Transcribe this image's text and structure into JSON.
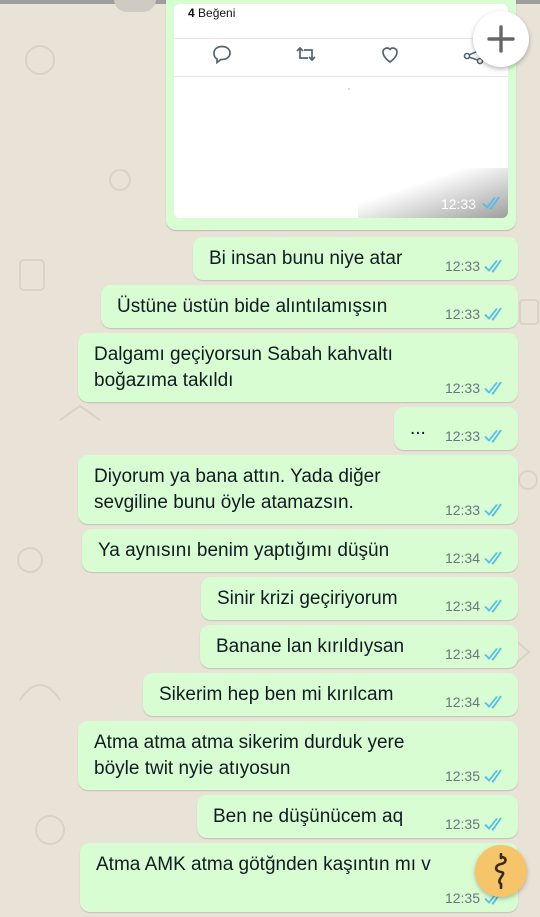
{
  "shared_post": {
    "likes_count": "4",
    "likes_label": "Beğeni",
    "time": "12:33",
    "actions": [
      "reply-icon",
      "retweet-icon",
      "like-icon",
      "share-icon"
    ]
  },
  "messages": [
    {
      "text": "Bi insan bunu niye atar",
      "time": "12:33"
    },
    {
      "text": "Üstüne üstün bide alıntılamışsın",
      "time": "12:33"
    },
    {
      "text": "Dalgamı geçiyorsun Sabah kahvaltı\nboğazıma takıldı",
      "time": "12:33"
    },
    {
      "text": "...",
      "time": "12:33"
    },
    {
      "text": "Diyorum ya bana attın. Yada diğer\nsevgiline bunu öyle atamazsın.",
      "time": "12:33"
    },
    {
      "text": "Ya aynısını benim yaptığımı düşün",
      "time": "12:34"
    },
    {
      "text": "Sinir krizi geçiriyorum",
      "time": "12:34"
    },
    {
      "text": "Banane lan kırıldıysan",
      "time": "12:34"
    },
    {
      "text": "Sikerim hep ben mi kırılcam",
      "time": "12:34"
    },
    {
      "text": "Atma atma atma sikerim durduk yere\nböyle twit nyie atıyosun",
      "time": "12:35"
    },
    {
      "text": "Ben ne düşünücem aq",
      "time": "12:35"
    },
    {
      "text": "Atma AMK atma götğnden kaşıntın mı v",
      "time": "12:35"
    }
  ],
  "colors": {
    "outgoing_bubble": "#d9fdd3",
    "read_receipt": "#53bdeb",
    "chat_background": "#e9e2d7",
    "fab": "#f6c56a"
  },
  "icons": {
    "plus": "plus-icon",
    "read_receipt": "double-check-icon",
    "fab": "squiggle-icon"
  }
}
